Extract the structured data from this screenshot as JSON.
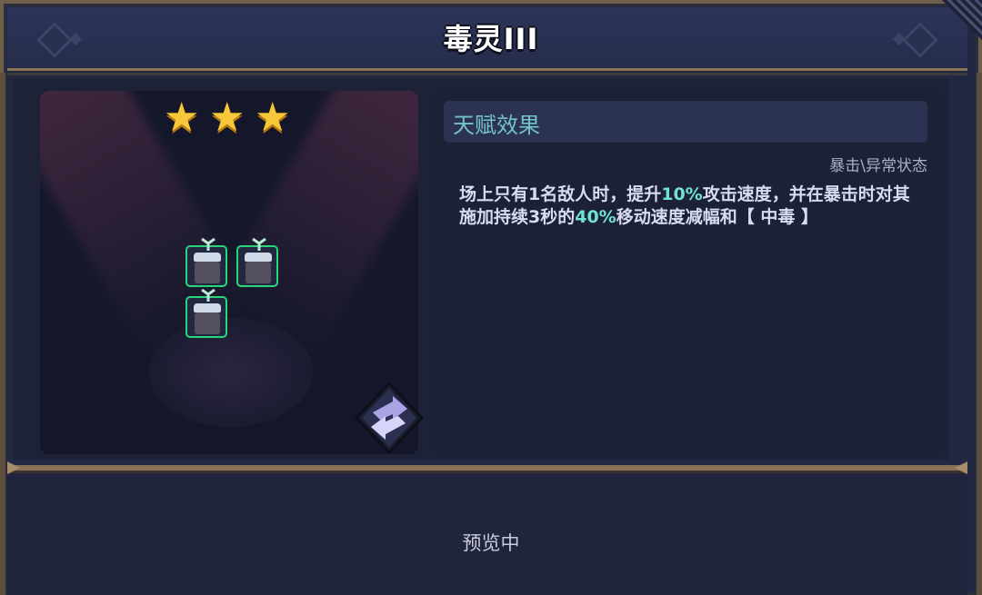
{
  "header": {
    "title": "毒灵III"
  },
  "hero": {
    "star_count": 3,
    "stars": [
      "★",
      "★",
      "★"
    ]
  },
  "talent": {
    "section_title": "天赋效果",
    "tags": "暴击\\异常状态",
    "description": {
      "part1": "场上只有1名敌人时，提升",
      "hl1": "10%",
      "part2": "攻击速度，并在暴击时对其施加持续3秒的",
      "hl2": "40%",
      "part3": "移动速度减幅和【 中毒 】"
    }
  },
  "footer": {
    "status": "预览中"
  },
  "colors": {
    "accent": "#6fe3d8",
    "star": "#f7c83a",
    "unit_border": "#27d67a",
    "frame": "#8a7255"
  },
  "icons": [
    "star-icon",
    "swap-icon",
    "unit-sprite"
  ]
}
